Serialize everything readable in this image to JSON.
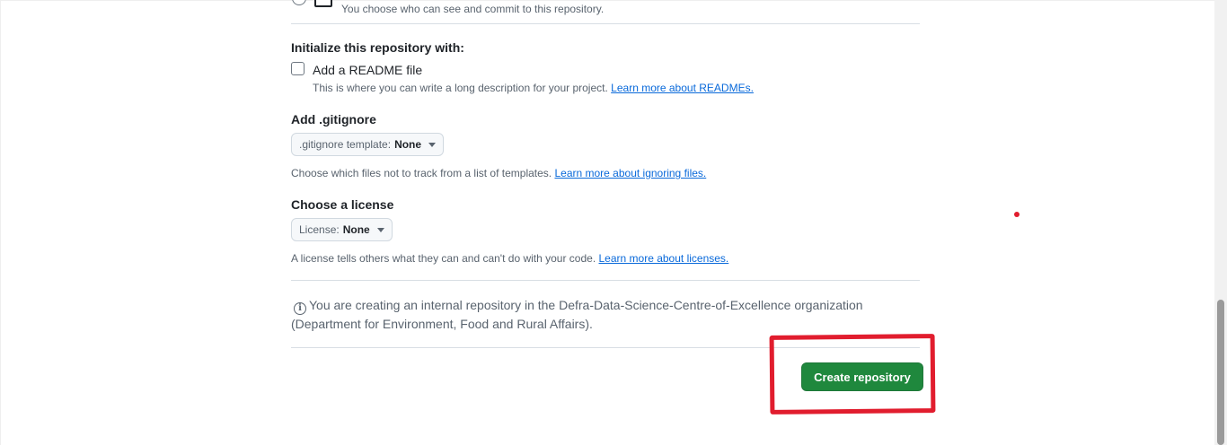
{
  "visibility_option": {
    "description": "You choose who can see and commit to this repository."
  },
  "initialize": {
    "title": "Initialize this repository with:",
    "readme_label": "Add a README file",
    "readme_note": "This is where you can write a long description for your project.",
    "readme_link": "Learn more about READMEs."
  },
  "gitignore": {
    "title": "Add .gitignore",
    "select_prefix": ".gitignore template:",
    "select_value": "None",
    "note": "Choose which files not to track from a list of templates.",
    "link": "Learn more about ignoring files."
  },
  "license": {
    "title": "Choose a license",
    "select_prefix": "License:",
    "select_value": "None",
    "note": "A license tells others what they can and can't do with your code.",
    "link": "Learn more about licenses."
  },
  "info": {
    "icon": "info-icon",
    "text": "You are creating an internal repository in the Defra-Data-Science-Centre-of-Excellence organization (Department for Environment, Food and Rural Affairs)."
  },
  "actions": {
    "create_label": "Create repository"
  },
  "colors": {
    "primary_button": "#1f883d",
    "link": "#0969da",
    "annotation": "#e11d2e"
  }
}
